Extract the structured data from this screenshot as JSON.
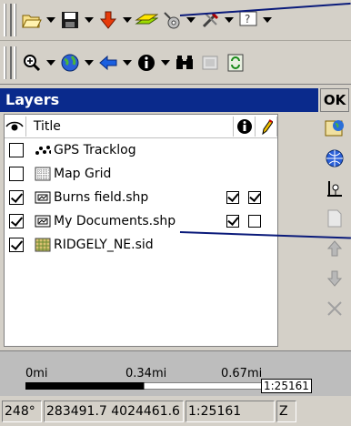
{
  "panel": {
    "title": "Layers",
    "ok_label": "OK",
    "column_title": "Title"
  },
  "layers": [
    {
      "label": "GPS Tracklog",
      "visible": false,
      "icon": "gps-tracklog-icon",
      "info": null,
      "edit": null
    },
    {
      "label": "Map Grid",
      "visible": false,
      "icon": "grid-icon",
      "info": null,
      "edit": null
    },
    {
      "label": "Burns field.shp",
      "visible": true,
      "icon": "shapefile-icon",
      "info": true,
      "edit": true
    },
    {
      "label": "My Documents.shp",
      "visible": true,
      "icon": "shapefile-icon",
      "info": true,
      "edit": false
    },
    {
      "label": "RIDGELY_NE.sid",
      "visible": true,
      "icon": "raster-icon",
      "info": null,
      "edit": null
    }
  ],
  "scale": {
    "labels": [
      "0mi",
      "0.34mi",
      "0.67mi"
    ],
    "ratio": "1:25161"
  },
  "status": {
    "heading": "248°",
    "coords": "283491.7 4024461.6",
    "scale": "1:25161",
    "extra": "Z"
  },
  "colors": {
    "header_bg": "#0a2a8c",
    "callout": "#0a1a7a"
  }
}
